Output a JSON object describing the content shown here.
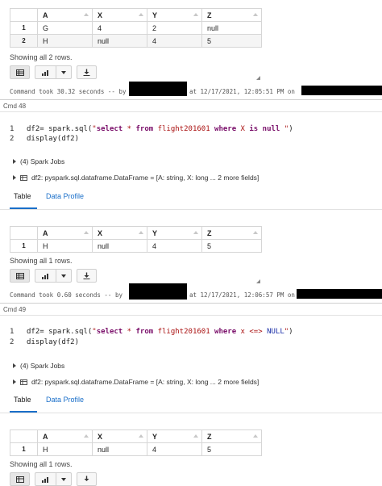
{
  "table_headers": [
    "",
    "A",
    "X",
    "Y",
    "Z"
  ],
  "block1": {
    "rows": [
      [
        "1",
        "G",
        "4",
        "2",
        "null"
      ],
      [
        "2",
        "H",
        "null",
        "4",
        "5"
      ]
    ],
    "showing": "Showing all 2 rows.",
    "command_time": "Command took 30.32 seconds -- by",
    "timestamp": "at 12/17/2021, 12:05:51 PM on"
  },
  "cmd48": {
    "label": "Cmd 48",
    "line_numbers": [
      "1",
      "2"
    ],
    "line1": {
      "a": "df2= spark.sql(",
      "s1": "\"",
      "k1": "select",
      "s2": " * ",
      "k2": "from",
      "s3": " flight201601 ",
      "k3": "where",
      "s4": " X ",
      "k4": "is",
      "s5": " ",
      "k5": "null",
      "s6": " \"",
      "b": ")"
    },
    "line2": "display(df2)",
    "spark_jobs": "(4) Spark Jobs",
    "dataframe": "df2:  pyspark.sql.dataframe.DataFrame = [A: string, X: long ... 2 more fields]",
    "tab_table": "Table",
    "tab_profile": "Data Profile"
  },
  "block2": {
    "rows": [
      [
        "1",
        "H",
        "null",
        "4",
        "5"
      ]
    ],
    "showing": "Showing all 1 rows.",
    "command_time": "Command took 0.60 seconds -- by",
    "timestamp": "at 12/17/2021, 12:06:57 PM on"
  },
  "cmd49": {
    "label": "Cmd 49",
    "line_numbers": [
      "1",
      "2"
    ],
    "line1": {
      "a": "df2= spark.sql(",
      "s1": "\"",
      "k1": "select",
      "s2": " * ",
      "k2": "from",
      "s3": " flight201601 ",
      "k3": "where",
      "s4": " x <=> ",
      "k5": "NULL",
      "s6": "\"",
      "b": ")"
    },
    "line2": "display(df2)",
    "spark_jobs": "(4) Spark Jobs",
    "dataframe": "df2:  pyspark.sql.dataframe.DataFrame = [A: string, X: long ... 2 more fields]",
    "tab_table": "Table",
    "tab_profile": "Data Profile"
  },
  "block3": {
    "rows": [
      [
        "1",
        "H",
        "null",
        "4",
        "5"
      ]
    ],
    "showing": "Showing all 1 rows."
  },
  "icons": {
    "table_view": "table-icon",
    "chart": "bar-chart-icon",
    "dropdown": "chevron-down-icon",
    "download": "download-icon",
    "expand": "chevron-right-icon",
    "dataframe": "dataframe-table-icon"
  },
  "colors": {
    "link": "#1a6fc9",
    "keyword": "#7a0f6a",
    "string": "#a11111"
  }
}
